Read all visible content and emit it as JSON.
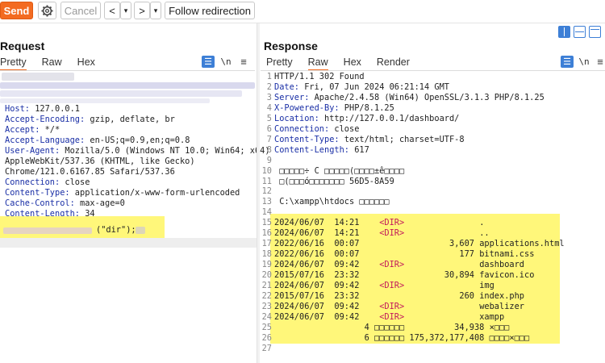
{
  "toolbar": {
    "send": "Send",
    "cancel": "Cancel",
    "back": "<",
    "forward": ">",
    "dropdown": "▾",
    "follow": "Follow redirection"
  },
  "request": {
    "title": "Request",
    "tabs": [
      "Pretty",
      "Raw",
      "Hex"
    ],
    "ln_icon": "\\n",
    "menu_icon": "≡",
    "lines": [
      {
        "key": "Host:",
        "val": " 127.0.0.1"
      },
      {
        "key": "Accept-Encoding:",
        "val": " gzip, deflate, br"
      },
      {
        "key": "Accept:",
        "val": " */*"
      },
      {
        "key": "Accept-Language:",
        "val": " en-US;q=0.9,en;q=0.8"
      },
      {
        "key": "User-Agent:",
        "val": " Mozilla/5.0 (Windows NT 10.0; Win64; x64)"
      },
      {
        "key": "",
        "val": "AppleWebKit/537.36 (KHTML, like Gecko)"
      },
      {
        "key": "",
        "val": "Chrome/121.0.6167.85 Safari/537.36"
      },
      {
        "key": "Connection:",
        "val": " close"
      },
      {
        "key": "Content-Type:",
        "val": " application/x-www-form-urlencoded"
      },
      {
        "key": "Cache-Control:",
        "val": " max-age=0"
      },
      {
        "key": "Content-Length:",
        "val": " 34"
      }
    ],
    "body_line": "(\"dir\");"
  },
  "response": {
    "title": "Response",
    "tabs": [
      "Pretty",
      "Raw",
      "Hex",
      "Render"
    ],
    "ln_icon": "\\n",
    "menu_icon": "≡",
    "headers": [
      {
        "n": "1",
        "key": "",
        "val": "HTTP/1.1 302 Found"
      },
      {
        "n": "2",
        "key": "Date:",
        "val": " Fri, 07 Jun 2024 06:21:14 GMT"
      },
      {
        "n": "3",
        "key": "Server:",
        "val": " Apache/2.4.58 (Win64) OpenSSL/3.1.3 PHP/8.1.25"
      },
      {
        "n": "4",
        "key": "X-Powered-By:",
        "val": " PHP/8.1.25"
      },
      {
        "n": "5",
        "key": "Location:",
        "val": " http://127.0.0.1/dashboard/"
      },
      {
        "n": "6",
        "key": "Connection:",
        "val": " close"
      },
      {
        "n": "7",
        "key": "Content-Type:",
        "val": " text/html; charset=UTF-8"
      },
      {
        "n": "8",
        "key": "Content-Length:",
        "val": " 617"
      },
      {
        "n": "9",
        "key": "",
        "val": ""
      },
      {
        "n": "10",
        "key": "",
        "val": " □□□□□÷ C □□□□□(□□□□±ê□□□□"
      },
      {
        "n": "11",
        "key": "",
        "val": " □(□□□ó□□□□□□□ 56D5-8A59"
      },
      {
        "n": "12",
        "key": "",
        "val": ""
      },
      {
        "n": "13",
        "key": "",
        "val": " C:\\xampp\\htdocs □□□□□□"
      },
      {
        "n": "14",
        "key": "",
        "val": ""
      }
    ],
    "listing": [
      {
        "n": "15",
        "date": "2024/06/07",
        "time": "14:21",
        "dir": "<DIR>",
        "size": "",
        "name": "."
      },
      {
        "n": "16",
        "date": "2024/06/07",
        "time": "14:21",
        "dir": "<DIR>",
        "size": "",
        "name": ".."
      },
      {
        "n": "17",
        "date": "2022/06/16",
        "time": "00:07",
        "dir": "",
        "size": "3,607",
        "name": "applications.html"
      },
      {
        "n": "18",
        "date": "2022/06/16",
        "time": "00:07",
        "dir": "",
        "size": "177",
        "name": "bitnami.css"
      },
      {
        "n": "19",
        "date": "2024/06/07",
        "time": "09:42",
        "dir": "<DIR>",
        "size": "",
        "name": "dashboard"
      },
      {
        "n": "20",
        "date": "2015/07/16",
        "time": "23:32",
        "dir": "",
        "size": "30,894",
        "name": "favicon.ico"
      },
      {
        "n": "21",
        "date": "2024/06/07",
        "time": "09:42",
        "dir": "<DIR>",
        "size": "",
        "name": "img"
      },
      {
        "n": "22",
        "date": "2015/07/16",
        "time": "23:32",
        "dir": "",
        "size": "260",
        "name": "index.php"
      },
      {
        "n": "23",
        "date": "2024/06/07",
        "time": "09:42",
        "dir": "<DIR>",
        "size": "",
        "name": "webalizer"
      },
      {
        "n": "24",
        "date": "2024/06/07",
        "time": "09:42",
        "dir": "<DIR>",
        "size": "",
        "name": "xampp"
      }
    ],
    "summary": [
      {
        "n": "25",
        "text": "                  4 □□□□□□          34,938 ×□□□"
      },
      {
        "n": "26",
        "text": "                  6 □□□□□□ 175,372,177,408 □□□□×□□□"
      },
      {
        "n": "27",
        "text": ""
      }
    ]
  },
  "colors": {
    "accent": "#f36b21",
    "highlight": "#fff77a",
    "header_key": "#1a2fa6",
    "dir_tag": "#c2185b"
  }
}
